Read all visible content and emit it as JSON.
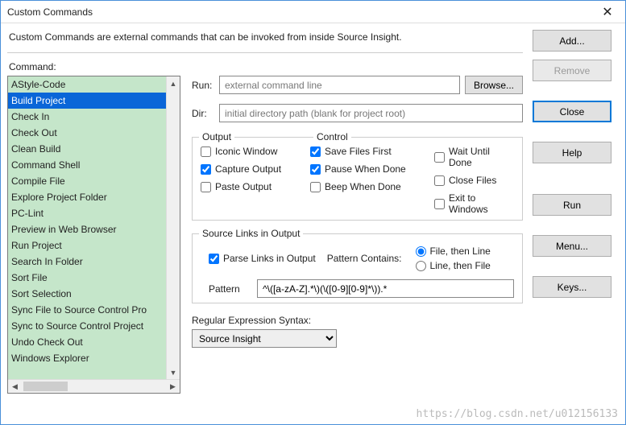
{
  "window": {
    "title": "Custom Commands"
  },
  "description": "Custom Commands are external commands that can be invoked from inside Source Insight.",
  "command_label": "Command:",
  "commands": {
    "items": [
      "AStyle-Code",
      "Build Project",
      "Check In",
      "Check Out",
      "Clean Build",
      "Command Shell",
      "Compile File",
      "Explore Project Folder",
      "PC-Lint",
      "Preview in Web Browser",
      "Run Project",
      "Search In Folder",
      "Sort File",
      "Sort Selection",
      "Sync File to Source Control Pro",
      "Sync to Source Control Project",
      "Undo Check Out",
      "Windows Explorer"
    ],
    "selected_index": 1
  },
  "fields": {
    "run_label": "Run:",
    "run_placeholder": "external command line",
    "run_value": "",
    "browse_label": "Browse...",
    "dir_label": "Dir:",
    "dir_placeholder": "initial directory path (blank for project root)",
    "dir_value": ""
  },
  "output_group": {
    "legend_output": "Output",
    "legend_control": "Control",
    "iconic": {
      "label": "Iconic Window",
      "checked": false
    },
    "capture": {
      "label": "Capture Output",
      "checked": true
    },
    "paste": {
      "label": "Paste Output",
      "checked": false
    },
    "save_first": {
      "label": "Save Files First",
      "checked": true
    },
    "pause_done": {
      "label": "Pause When Done",
      "checked": true
    },
    "beep_done": {
      "label": "Beep When Done",
      "checked": false
    },
    "wait_done": {
      "label": "Wait Until Done",
      "checked": false
    },
    "close_files": {
      "label": "Close Files",
      "checked": false
    },
    "exit_windows": {
      "label": "Exit to Windows",
      "checked": false
    }
  },
  "links_group": {
    "legend": "Source Links in Output",
    "parse": {
      "label": "Parse Links in Output",
      "checked": true
    },
    "contains_label": "Pattern Contains:",
    "file_then_line": "File, then Line",
    "line_then_file": "Line, then File",
    "radio_selected": "file_then_line",
    "pattern_label": "Pattern",
    "pattern_value": "^\\([a-zA-Z].*\\)(\\([0-9][0-9]*\\)).*"
  },
  "regex": {
    "label": "Regular Expression Syntax:",
    "value": "Source Insight"
  },
  "buttons": {
    "add": "Add...",
    "remove": "Remove",
    "close": "Close",
    "help": "Help",
    "run": "Run",
    "menu": "Menu...",
    "keys": "Keys..."
  },
  "watermark": "https://blog.csdn.net/u012156133"
}
